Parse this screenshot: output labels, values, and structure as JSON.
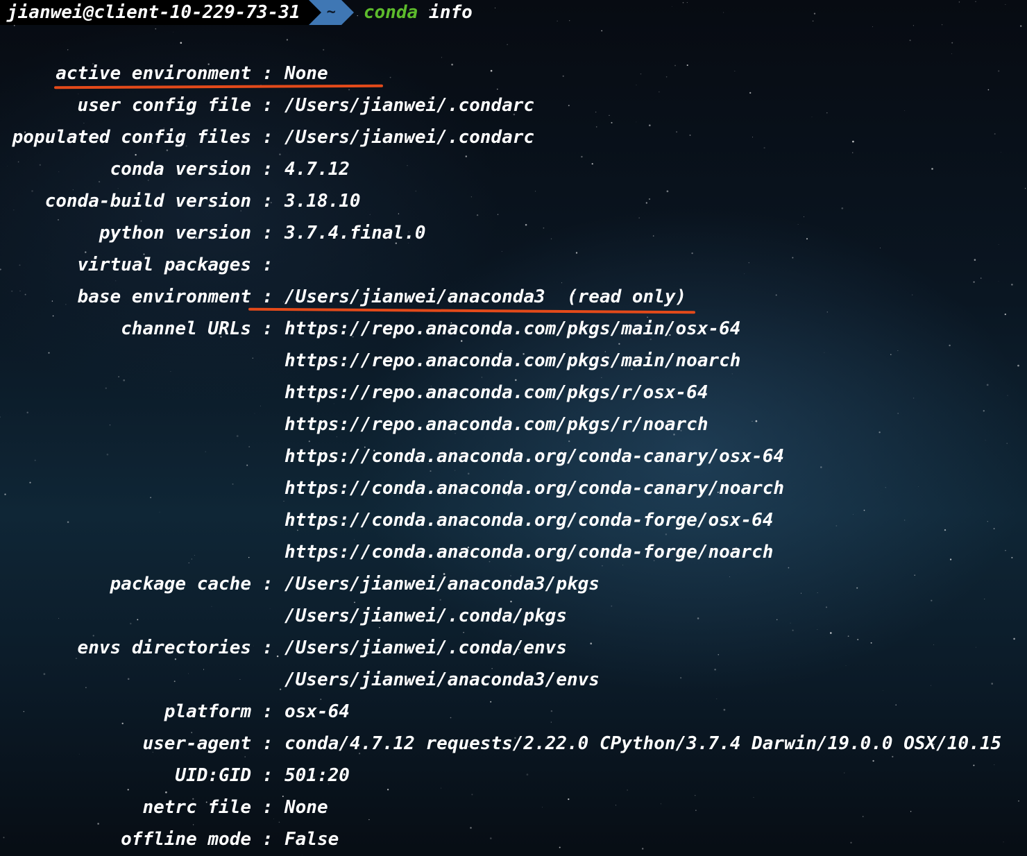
{
  "prompt": {
    "user_host": "jianwei@client-10-229-73-31",
    "directory": "~",
    "command_name": "conda",
    "command_arg": "info"
  },
  "colors": {
    "prompt_dir_bg": "#3f77b4",
    "command_green": "#5dbb2c",
    "annotation_underline": "#e34a1a"
  },
  "separator": ":",
  "rows": [
    {
      "key": "active environment",
      "value": "None"
    },
    {
      "key": "user config file",
      "value": "/Users/jianwei/.condarc"
    },
    {
      "key": "populated config files",
      "value": "/Users/jianwei/.condarc"
    },
    {
      "key": "conda version",
      "value": "4.7.12"
    },
    {
      "key": "conda-build version",
      "value": "3.18.10"
    },
    {
      "key": "python version",
      "value": "3.7.4.final.0"
    },
    {
      "key": "virtual packages",
      "value": ""
    },
    {
      "key": "base environment",
      "value": "/Users/jianwei/anaconda3  (read only)"
    },
    {
      "key": "channel URLs",
      "value": "https://repo.anaconda.com/pkgs/main/osx-64"
    },
    {
      "key": "",
      "value": "https://repo.anaconda.com/pkgs/main/noarch"
    },
    {
      "key": "",
      "value": "https://repo.anaconda.com/pkgs/r/osx-64"
    },
    {
      "key": "",
      "value": "https://repo.anaconda.com/pkgs/r/noarch"
    },
    {
      "key": "",
      "value": "https://conda.anaconda.org/conda-canary/osx-64"
    },
    {
      "key": "",
      "value": "https://conda.anaconda.org/conda-canary/noarch"
    },
    {
      "key": "",
      "value": "https://conda.anaconda.org/conda-forge/osx-64"
    },
    {
      "key": "",
      "value": "https://conda.anaconda.org/conda-forge/noarch"
    },
    {
      "key": "package cache",
      "value": "/Users/jianwei/anaconda3/pkgs"
    },
    {
      "key": "",
      "value": "/Users/jianwei/.conda/pkgs"
    },
    {
      "key": "envs directories",
      "value": "/Users/jianwei/.conda/envs"
    },
    {
      "key": "",
      "value": "/Users/jianwei/anaconda3/envs"
    },
    {
      "key": "platform",
      "value": "osx-64"
    },
    {
      "key": "user-agent",
      "value": "conda/4.7.12 requests/2.22.0 CPython/3.7.4 Darwin/19.0.0 OSX/10.15"
    },
    {
      "key": "UID:GID",
      "value": "501:20"
    },
    {
      "key": "netrc file",
      "value": "None"
    },
    {
      "key": "offline mode",
      "value": "False"
    }
  ]
}
